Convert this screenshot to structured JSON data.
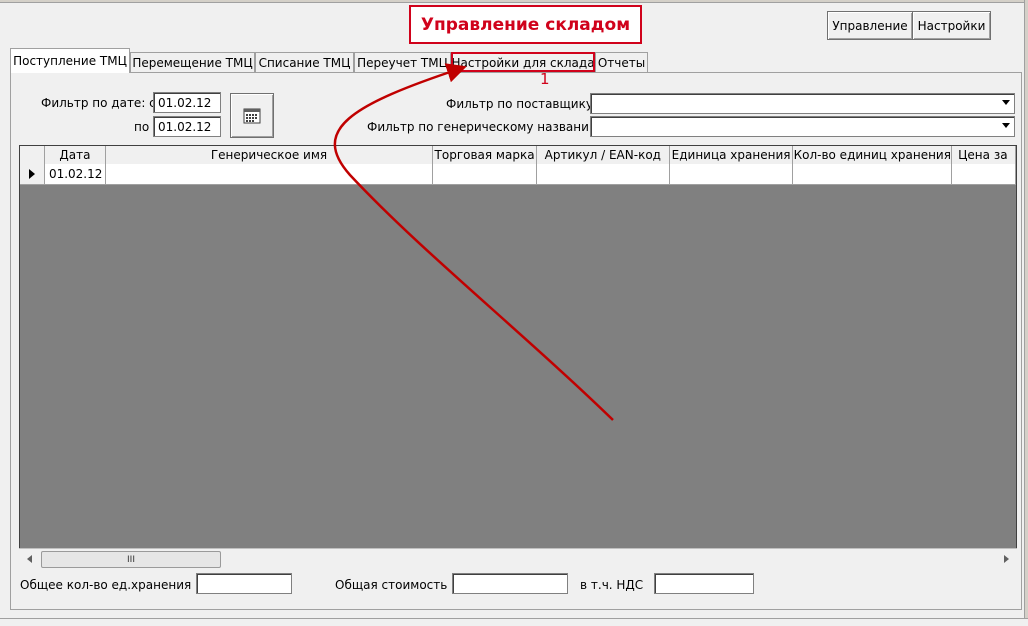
{
  "window": {
    "title": "Управление складом",
    "top_buttons": [
      "Управление",
      "Настройки"
    ]
  },
  "tabs": [
    {
      "label": "Поступление ТМЦ",
      "active": true
    },
    {
      "label": "Перемещение ТМЦ",
      "active": false
    },
    {
      "label": "Списание ТМЦ",
      "active": false
    },
    {
      "label": "Переучет ТМЦ",
      "active": false
    },
    {
      "label": "Настройки для склада",
      "active": false,
      "highlighted": true
    },
    {
      "label": "Отчеты",
      "active": false
    }
  ],
  "annotation": {
    "number": "1",
    "color": "#d0021b"
  },
  "filters": {
    "date_label": "Фильтр по дате: с",
    "date_from": "01.02.12",
    "to_label": "по",
    "date_to": "01.02.12",
    "calendar_icon": "calendar-icon",
    "supplier_label": "Фильтр по поставщику",
    "supplier_value": "",
    "generic_label": "Фильтр по генерическому названию",
    "generic_value": ""
  },
  "grid": {
    "columns": [
      "Дата",
      "Генерическое имя",
      "Торговая марка",
      "Артикул / EAN-код",
      "Единица хранения",
      "Кол-во единиц хранения",
      "Цена за"
    ],
    "rows": [
      [
        "01.02.12",
        "",
        "",
        "",
        "",
        "",
        ""
      ]
    ],
    "scroll_thumb_label": "III"
  },
  "footer": {
    "total_units_label": "Общее кол-во ед.хранения",
    "total_units_value": "",
    "total_cost_label": "Общая стоимость",
    "total_cost_value": "",
    "vat_label": "в т.ч. НДС",
    "vat_value": ""
  }
}
